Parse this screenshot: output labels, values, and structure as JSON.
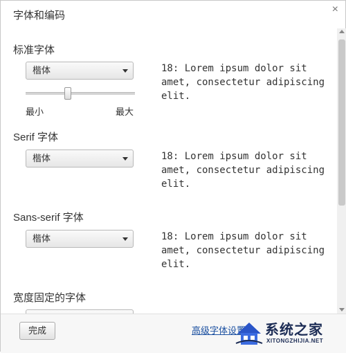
{
  "dialog": {
    "title": "字体和编码",
    "close_label": "×"
  },
  "sections": [
    {
      "title": "标准字体",
      "select_value": "楷体",
      "preview": "18: Lorem ipsum dolor sit amet, consectetur adipiscing elit."
    },
    {
      "title": "Serif 字体",
      "select_value": "楷体",
      "preview": "18: Lorem ipsum dolor sit amet, consectetur adipiscing elit."
    },
    {
      "title": "Sans-serif 字体",
      "select_value": "楷体",
      "preview": "18: Lorem ipsum dolor sit amet, consectetur adipiscing elit."
    },
    {
      "title": "宽度固定的字体"
    }
  ],
  "slider": {
    "min_label": "最小",
    "max_label": "最大",
    "value_fraction": 0.38
  },
  "footer": {
    "done_label": "完成",
    "advanced_link": "高级字体设置"
  },
  "watermark": {
    "brand": "系统之家",
    "site": "XITONGZHIJIA.NET"
  }
}
